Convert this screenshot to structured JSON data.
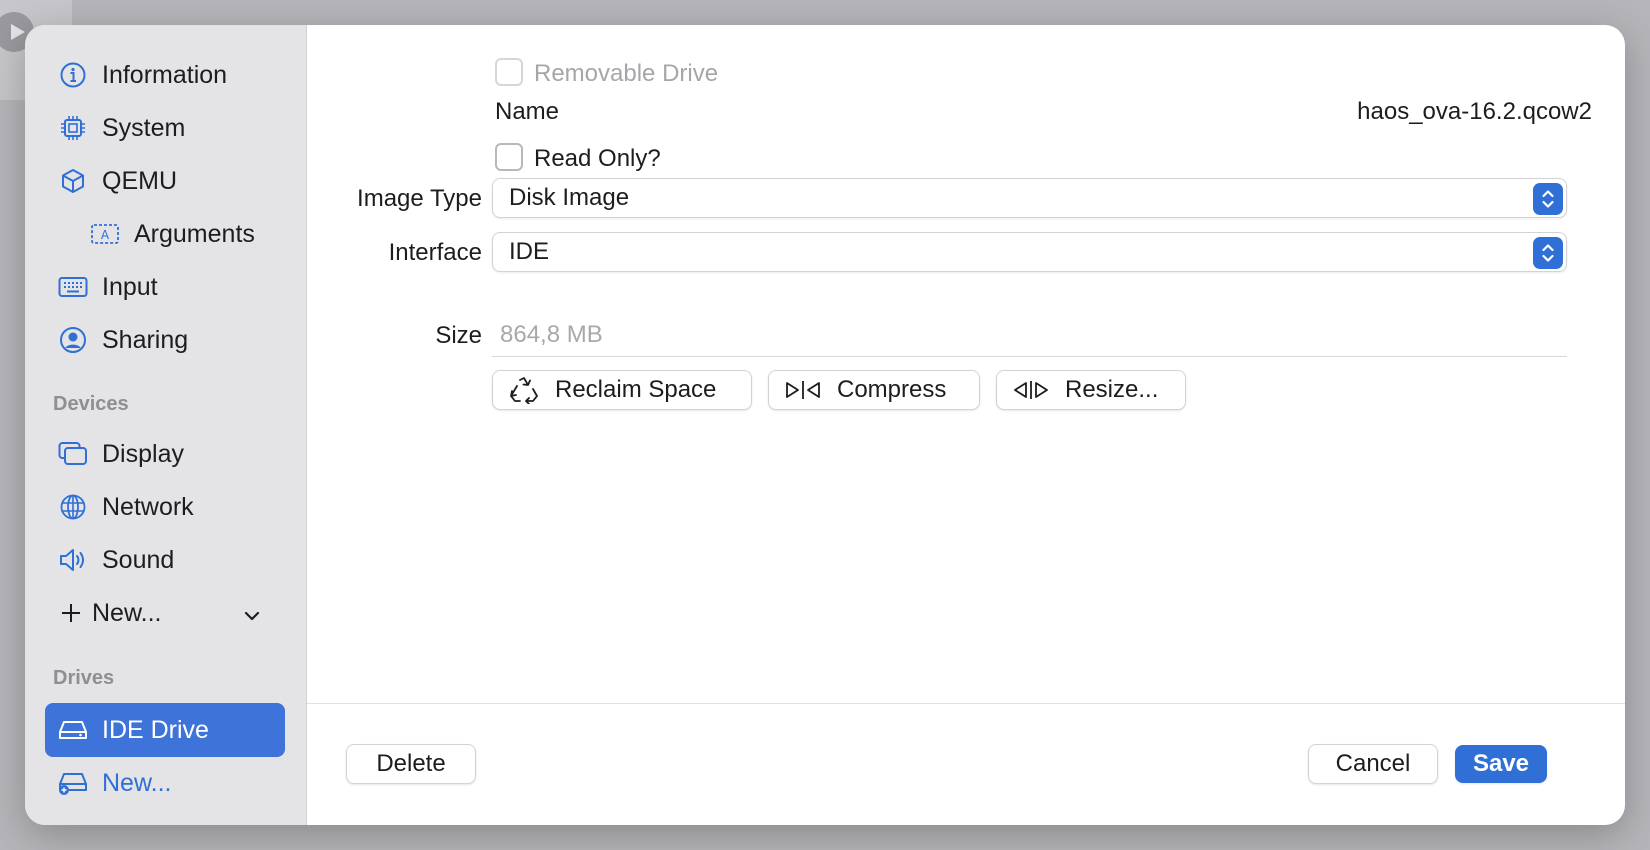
{
  "sidebar": {
    "items": [
      {
        "label": "Information",
        "icon": "info-icon"
      },
      {
        "label": "System",
        "icon": "chip-icon"
      },
      {
        "label": "QEMU",
        "icon": "cube-icon"
      },
      {
        "label": "Arguments",
        "icon": "text-field-icon"
      },
      {
        "label": "Input",
        "icon": "keyboard-icon"
      },
      {
        "label": "Sharing",
        "icon": "person-circle-icon"
      }
    ],
    "devices_heading": "Devices",
    "devices": [
      {
        "label": "Display",
        "icon": "display-icon"
      },
      {
        "label": "Network",
        "icon": "globe-icon"
      },
      {
        "label": "Sound",
        "icon": "speaker-icon"
      }
    ],
    "new_device_label": "New...",
    "drives_heading": "Drives",
    "drives": [
      {
        "label": "IDE Drive",
        "icon": "drive-icon",
        "selected": true
      }
    ],
    "new_drive_label": "New..."
  },
  "form": {
    "removable_label": "Removable Drive",
    "removable_checked": false,
    "name_label": "Name",
    "name_value": "haos_ova-16.2.qcow2",
    "readonly_label": "Read Only?",
    "readonly_checked": false,
    "image_type_label": "Image Type",
    "image_type_value": "Disk Image",
    "interface_label": "Interface",
    "interface_value": "IDE",
    "size_label": "Size",
    "size_value": "864,8 MB"
  },
  "actions": {
    "reclaim_label": "Reclaim Space",
    "compress_label": "Compress",
    "resize_label": "Resize..."
  },
  "footer": {
    "delete_label": "Delete",
    "cancel_label": "Cancel",
    "save_label": "Save"
  },
  "colors": {
    "accent": "#2f6fd6",
    "selected_bg": "#3e73d9",
    "sidebar_bg": "#e4e4e6"
  }
}
